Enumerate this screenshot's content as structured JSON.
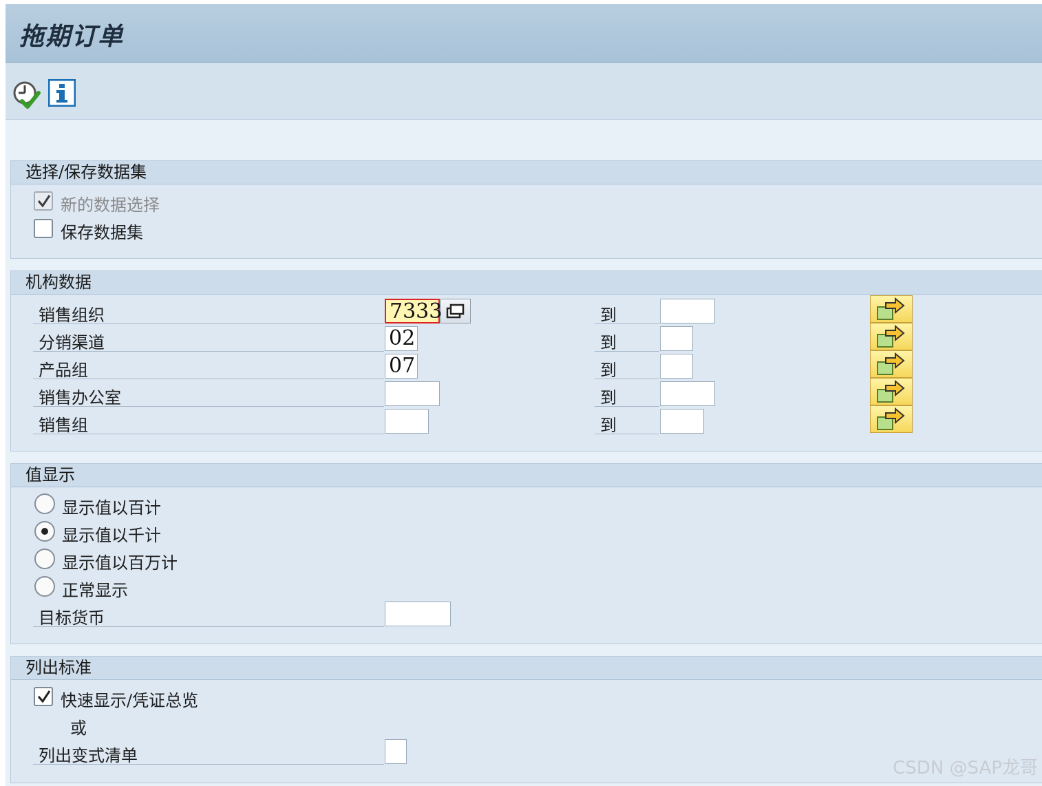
{
  "title": "拖期订单",
  "toolbar": {
    "execute_icon": "clock-check-icon",
    "info_icon": "info-icon"
  },
  "group_dataset": {
    "header": "选择/保存数据集",
    "new_selection": {
      "label": "新的数据选择",
      "checked": true,
      "disabled": true
    },
    "save_dataset": {
      "label": "保存数据集",
      "checked": false
    }
  },
  "group_org": {
    "header": "机构数据",
    "to_label": "到",
    "rows": [
      {
        "label": "销售组织",
        "from": "7333",
        "to": ""
      },
      {
        "label": "分销渠道",
        "from": "02",
        "to": ""
      },
      {
        "label": "产品组",
        "from": "07",
        "to": ""
      },
      {
        "label": "销售办公室",
        "from": "",
        "to": ""
      },
      {
        "label": "销售组",
        "from": "",
        "to": ""
      }
    ]
  },
  "group_display": {
    "header": "值显示",
    "options": [
      {
        "label": "显示值以百计",
        "selected": false
      },
      {
        "label": "显示值以千计",
        "selected": true
      },
      {
        "label": "显示值以百万计",
        "selected": false
      },
      {
        "label": "正常显示",
        "selected": false
      }
    ],
    "currency_label": "目标货币",
    "currency_value": ""
  },
  "group_list": {
    "header": "列出标准",
    "quick_display": {
      "label": "快速显示/凭证总览",
      "checked": true
    },
    "or_label": "或",
    "variant_label": "列出变式清单",
    "variant_value": ""
  },
  "watermark": "CSDN @SAP龙哥",
  "colors": {
    "title_bar": "#a8c2d8",
    "active_field": "#fff6b4",
    "multi_select": "#f6d75c"
  }
}
